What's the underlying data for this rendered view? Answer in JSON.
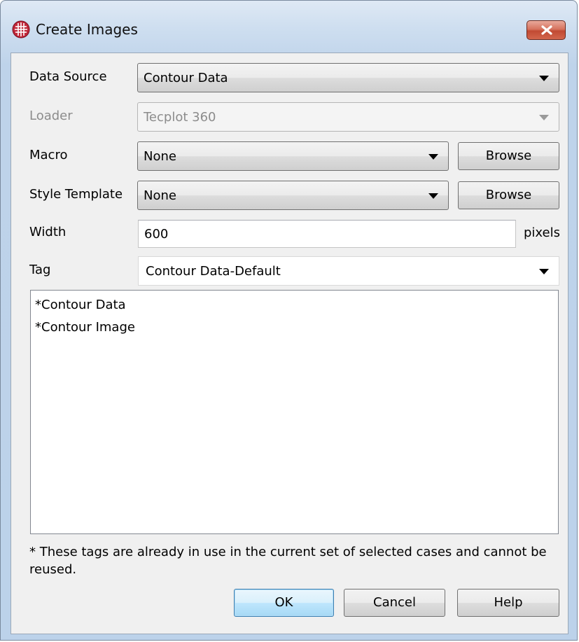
{
  "window": {
    "title": "Create Images",
    "close_icon": "close-x-icon",
    "app_icon": "tecplot-grid-icon",
    "accent_close": "#c14a33"
  },
  "form": {
    "data_source": {
      "label": "Data Source",
      "value": "Contour Data"
    },
    "loader": {
      "label": "Loader",
      "value": "Tecplot 360"
    },
    "macro": {
      "label": "Macro",
      "value": "None",
      "browse": "Browse"
    },
    "style_template": {
      "label": "Style Template",
      "value": "None",
      "browse": "Browse"
    },
    "width": {
      "label": "Width",
      "value": "600",
      "unit": "pixels"
    },
    "tag": {
      "label": "Tag",
      "value": "Contour Data-Default"
    }
  },
  "tag_list": {
    "items": [
      "*Contour Data",
      "*Contour Image"
    ]
  },
  "footnote": "* These tags are already in use in the current set of selected cases and cannot be reused.",
  "buttons": {
    "ok": "OK",
    "cancel": "Cancel",
    "help": "Help"
  }
}
